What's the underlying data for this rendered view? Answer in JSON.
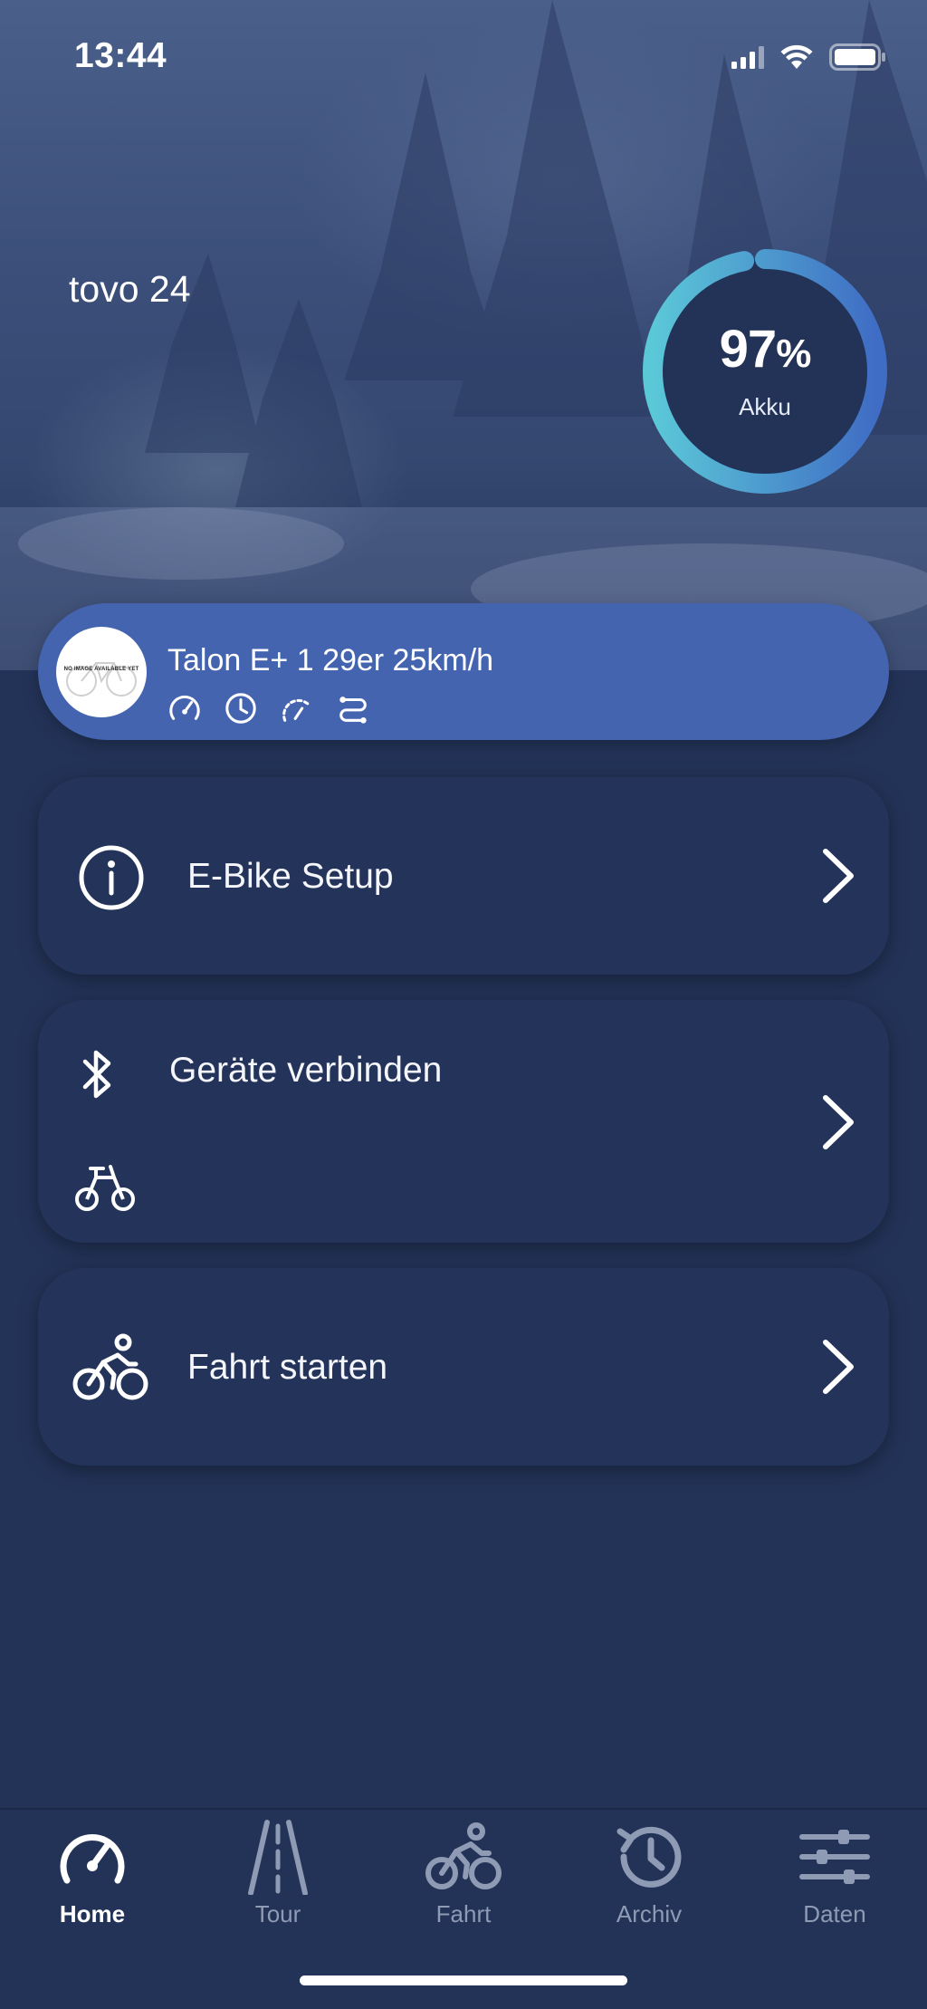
{
  "status_bar": {
    "time": "13:44",
    "icons": [
      "cellular-signal-icon",
      "wifi-icon",
      "battery-icon"
    ]
  },
  "header": {
    "bike_title": "tovo 24"
  },
  "battery": {
    "percent": 97,
    "value_text": "97",
    "unit": "%",
    "label": "Akku"
  },
  "bike_card": {
    "name": "Talon E+ 1 29er 25km/h",
    "image_placeholder": "NO IMAGE AVAILABLE YET",
    "metric_icons": [
      "speedometer-icon",
      "clock-icon",
      "gauge-icon",
      "route-icon"
    ]
  },
  "menu": [
    {
      "label": "E-Bike Setup",
      "icon": "info-icon"
    },
    {
      "label": "Geräte verbinden",
      "icon": "bluetooth-icon",
      "sub_icon": "bike-icon"
    },
    {
      "label": "Fahrt starten",
      "icon": "cyclist-icon"
    }
  ],
  "tabs": [
    {
      "label": "Home",
      "icon": "speedometer-icon",
      "active": true
    },
    {
      "label": "Tour",
      "icon": "road-icon",
      "active": false
    },
    {
      "label": "Fahrt",
      "icon": "cyclist-icon",
      "active": false
    },
    {
      "label": "Archiv",
      "icon": "history-icon",
      "active": false
    },
    {
      "label": "Daten",
      "icon": "sliders-icon",
      "active": false
    }
  ],
  "colors": {
    "background": "#233358",
    "card": "#243359",
    "accent_pill": "#4464b0",
    "gauge_start": "#5bc8d8",
    "gauge_end": "#3f6cc4",
    "tab_inactive": "#8f9bb4"
  }
}
